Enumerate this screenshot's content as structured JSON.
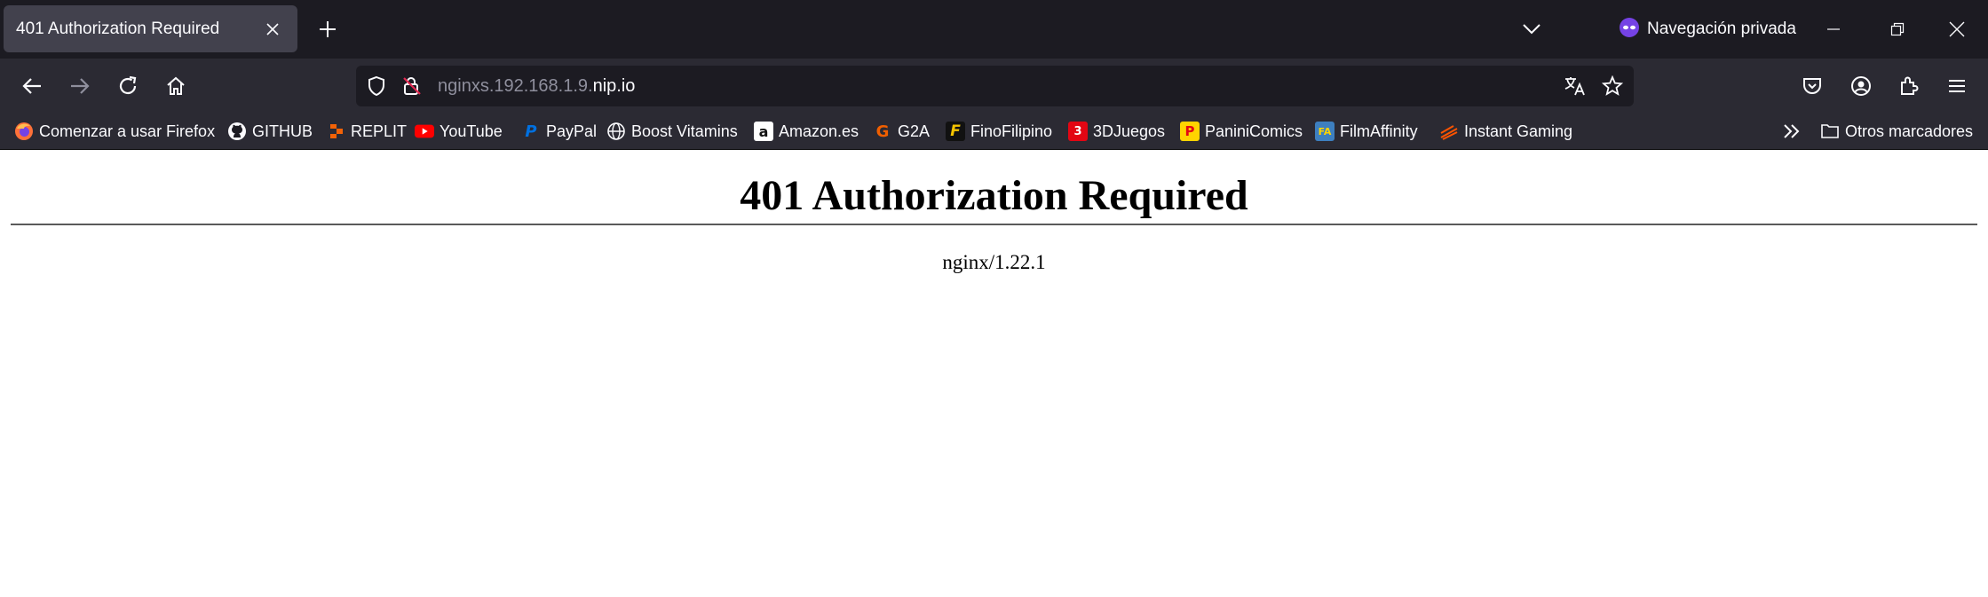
{
  "tab": {
    "title": "401 Authorization Required"
  },
  "private_mode": {
    "label": "Navegación privada"
  },
  "urlbar": {
    "host_prefix": "nginxs.192.168.1.9.",
    "host_domain": "nip.io"
  },
  "bookmarks": [
    {
      "label": "Comenzar a usar Firefox",
      "icon": "firefox-icon"
    },
    {
      "label": "GITHUB",
      "icon": "github-icon"
    },
    {
      "label": "REPLIT",
      "icon": "replit-icon"
    },
    {
      "label": "YouTube",
      "icon": "youtube-icon"
    },
    {
      "label": "PayPal",
      "icon": "paypal-icon"
    },
    {
      "label": "Boost Vitamins",
      "icon": "globe-icon"
    },
    {
      "label": "Amazon.es",
      "icon": "amazon-icon"
    },
    {
      "label": "G2A",
      "icon": "g2a-icon"
    },
    {
      "label": "FinoFilipino",
      "icon": "finofilipino-icon"
    },
    {
      "label": "3DJuegos",
      "icon": "3djuegos-icon"
    },
    {
      "label": "PaniniComics",
      "icon": "panini-icon"
    },
    {
      "label": "FilmAffinity",
      "icon": "filmaffinity-icon"
    },
    {
      "label": "Instant Gaming",
      "icon": "instant-gaming-icon"
    }
  ],
  "other_bookmarks": {
    "label": "Otros marcadores"
  },
  "page": {
    "heading": "401 Authorization Required",
    "server": "nginx/1.22.1"
  },
  "colors": {
    "tabbar_bg": "#1c1b22",
    "toolbar_bg": "#2b2a33",
    "active_tab_bg": "#42414d",
    "private_icon": "#7542e5"
  }
}
